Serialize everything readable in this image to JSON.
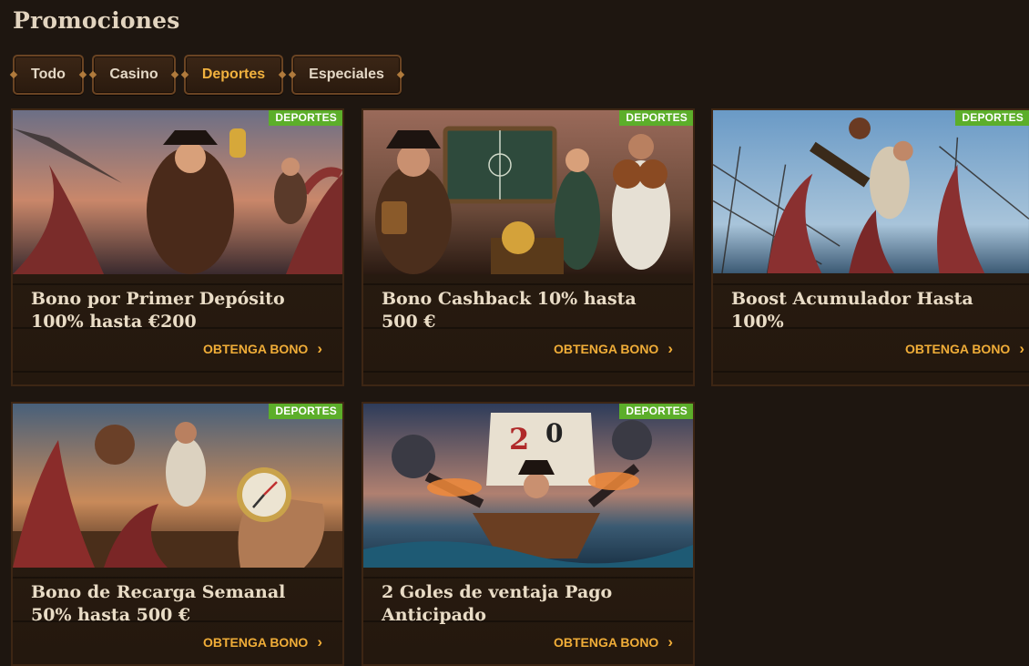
{
  "page_title": "Promociones",
  "tabs": [
    {
      "label": "Todo"
    },
    {
      "label": "Casino"
    },
    {
      "label": "Deportes",
      "active": true
    },
    {
      "label": "Especiales"
    }
  ],
  "colors": {
    "accent": "#f0ad38",
    "badge": "#5cae2a",
    "background": "#1e1610"
  },
  "cards": [
    {
      "badge": "DEPORTES",
      "title": "Bono por Primer Depósito 100% hasta €200",
      "cta": "OBTENGA BONO",
      "image": "pirate-captain-trophy-kraken"
    },
    {
      "badge": "DEPORTES",
      "title": "Bono Cashback 10% hasta 500 €",
      "cta": "OBTENGA BONO",
      "image": "pirates-tactics-board-treasure"
    },
    {
      "badge": "DEPORTES",
      "title": "Boost Acumulador Hasta 100%",
      "cta": "OBTENGA BONO",
      "image": "pirate-kick-kraken-rigging"
    },
    {
      "badge": "DEPORTES",
      "title": "Bono de Recarga Semanal 50% hasta 500 €",
      "cta": "OBTENGA BONO",
      "image": "compass-kraken-deck"
    },
    {
      "badge": "DEPORTES",
      "title": "2 Goles de ventaja Pago Anticipado",
      "cta": "OBTENGA BONO",
      "image": "pirate-ship-cannons-balls"
    }
  ]
}
